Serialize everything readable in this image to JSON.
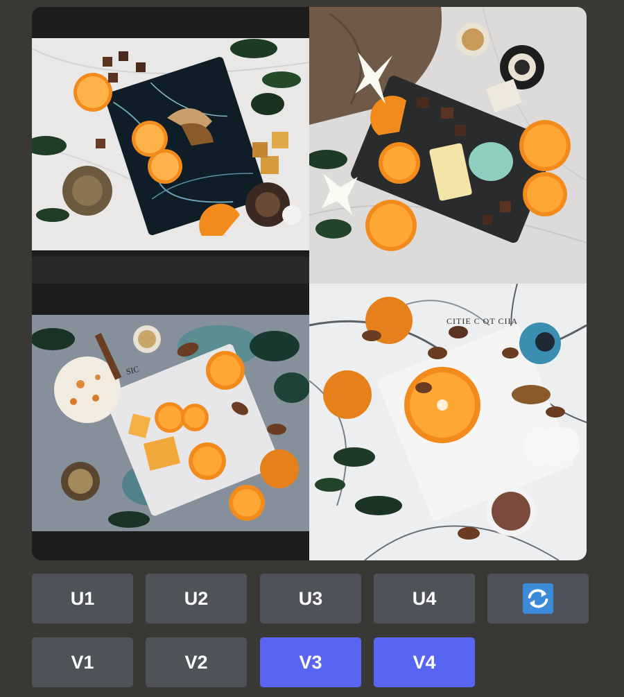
{
  "image_grid": {
    "tiles": [
      {
        "index": 1,
        "overlay_text": ""
      },
      {
        "index": 2,
        "overlay_text": ""
      },
      {
        "index": 3,
        "overlay_text": "SIC"
      },
      {
        "index": 4,
        "overlay_text": "CITIE C OT CIIA"
      }
    ]
  },
  "upscale_buttons": [
    {
      "label": "U1",
      "active": false
    },
    {
      "label": "U2",
      "active": false
    },
    {
      "label": "U3",
      "active": false
    },
    {
      "label": "U4",
      "active": false
    }
  ],
  "reroll_button": {
    "icon": "refresh-icon",
    "color": "#3b8bd9"
  },
  "variation_buttons": [
    {
      "label": "V1",
      "active": false
    },
    {
      "label": "V2",
      "active": false
    },
    {
      "label": "V3",
      "active": true
    },
    {
      "label": "V4",
      "active": true
    }
  ],
  "colors": {
    "background": "#3a3834",
    "button": "#4f5359",
    "button_active": "#5865f2",
    "orange": "#f28a1c"
  }
}
